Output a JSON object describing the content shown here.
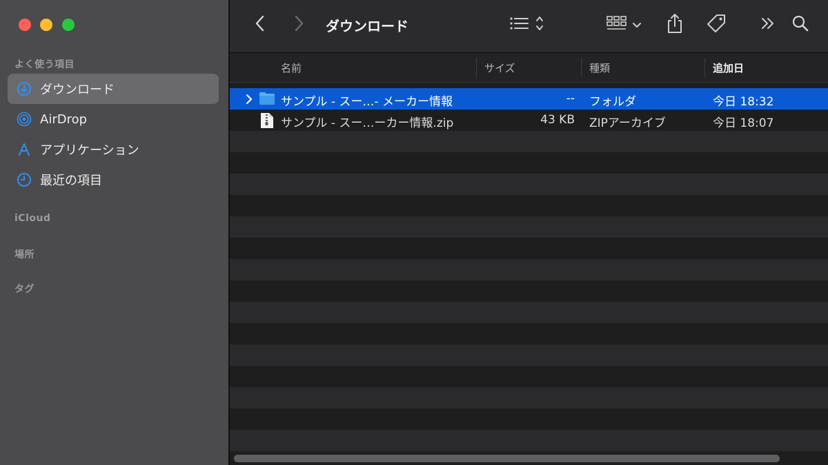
{
  "window": {
    "title": "ダウンロード",
    "colors": {
      "sidebar_bg": "#4b4b4d",
      "selection": "#0a5bd3",
      "accent_icon": "#2f8ff5"
    }
  },
  "sidebar": {
    "sections": {
      "favorites": "よく使う項目",
      "icloud": "iCloud",
      "locations": "場所",
      "tags": "タグ"
    },
    "items": [
      {
        "label": "ダウンロード",
        "icon": "download-circle-icon",
        "selected": true
      },
      {
        "label": "AirDrop",
        "icon": "airdrop-icon",
        "selected": false
      },
      {
        "label": "アプリケーション",
        "icon": "applications-icon",
        "selected": false
      },
      {
        "label": "最近の項目",
        "icon": "clock-icon",
        "selected": false
      }
    ]
  },
  "toolbar": {
    "back": "chevron-left-icon",
    "forward": "chevron-right-icon",
    "view_mode": "list-view-icon",
    "group": "grid-group-icon",
    "share": "share-icon",
    "tag": "tag-icon",
    "more": "double-chevron-icon",
    "search": "search-icon"
  },
  "columns": {
    "name": "名前",
    "size": "サイズ",
    "kind": "種類",
    "date_added": "追加日"
  },
  "files": [
    {
      "name": "サンプル - スー…- メーカー情報",
      "size": "--",
      "kind": "フォルダ",
      "date_added": "今日 18:32",
      "icon": "folder-icon",
      "selected": true
    },
    {
      "name": "サンプル - スー…ーカー情報.zip",
      "size": "43 KB",
      "kind": "ZIPアーカイブ",
      "date_added": "今日 18:07",
      "icon": "zip-file-icon",
      "selected": false
    }
  ]
}
